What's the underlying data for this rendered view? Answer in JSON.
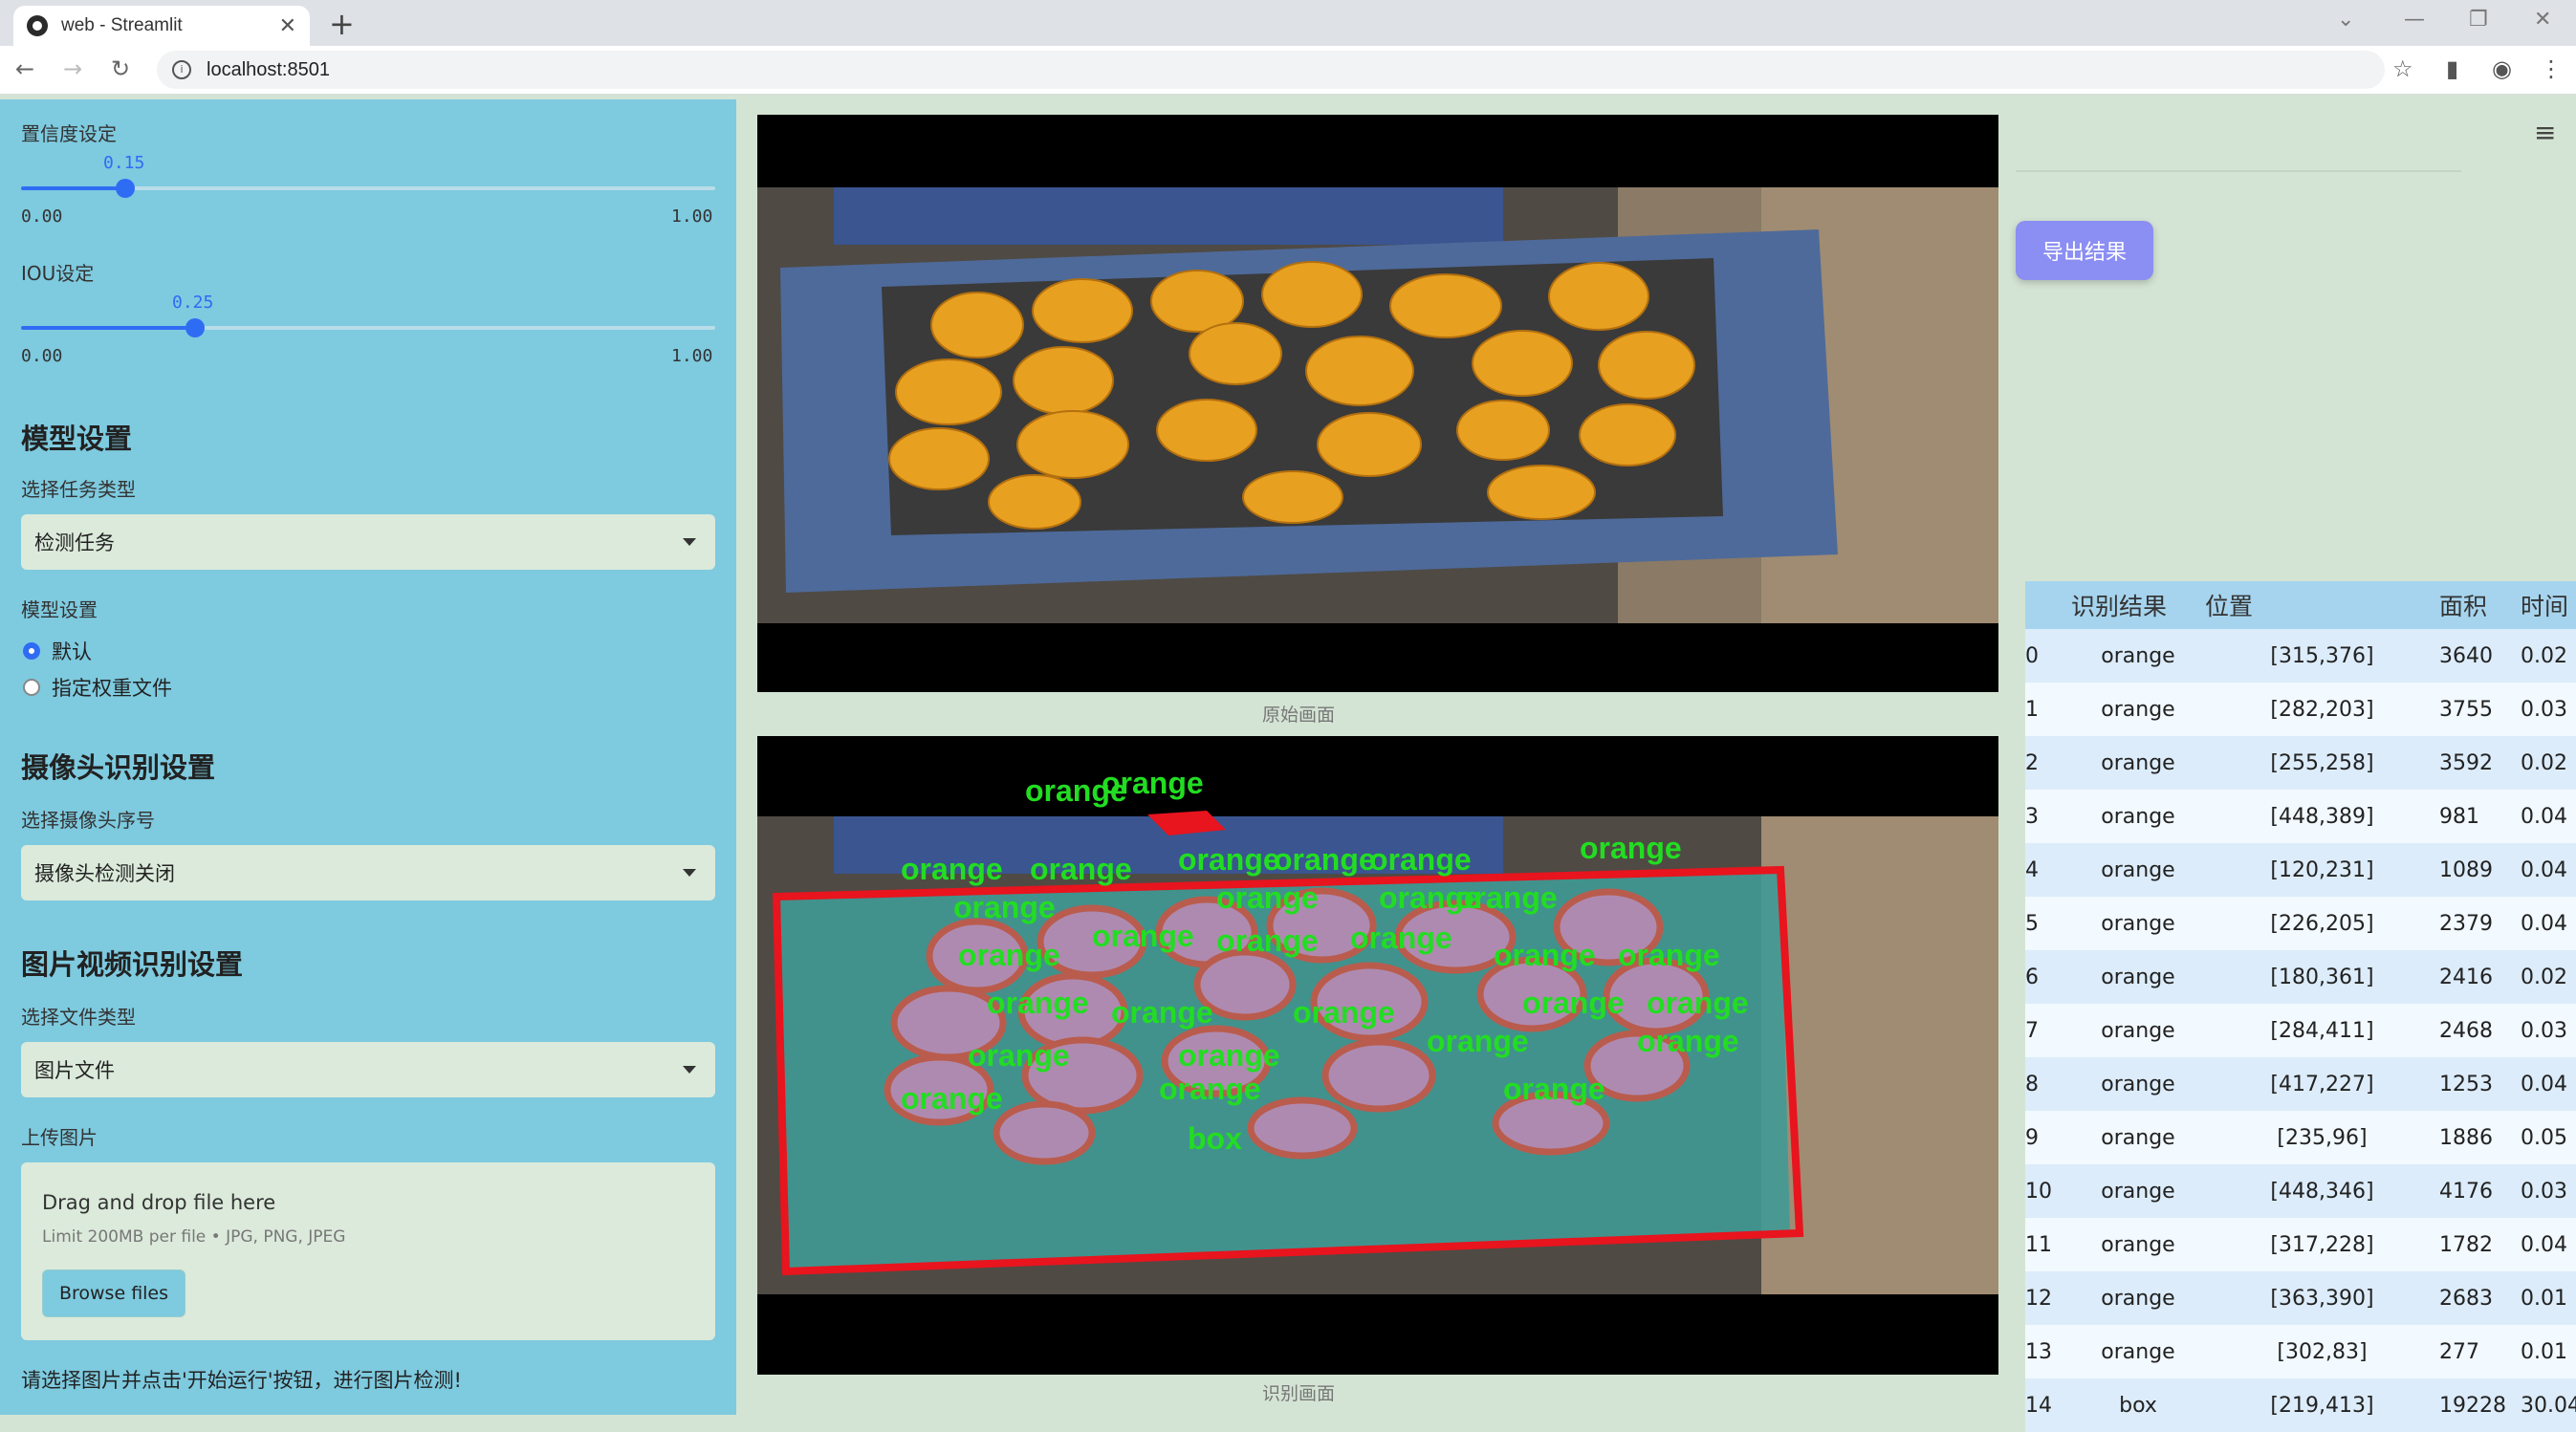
{
  "browser": {
    "tab_title": "web - Streamlit",
    "url": "localhost:8501"
  },
  "sidebar": {
    "confidence": {
      "label": "置信度设定",
      "value": "0.15",
      "fraction": 0.15,
      "min": "0.00",
      "max": "1.00"
    },
    "iou": {
      "label": "IOU设定",
      "value": "0.25",
      "fraction": 0.25,
      "min": "0.00",
      "max": "1.00"
    },
    "model_section": "模型设置",
    "task_label": "选择任务类型",
    "task_value": "检测任务",
    "model_label": "模型设置",
    "radio_default": "默认",
    "radio_custom": "指定权重文件",
    "camera_section": "摄像头识别设置",
    "camera_label": "选择摄像头序号",
    "camera_value": "摄像头检测关闭",
    "media_section": "图片视频识别设置",
    "filetype_label": "选择文件类型",
    "filetype_value": "图片文件",
    "upload_label": "上传图片",
    "upload_drag": "Drag and drop file here",
    "upload_limit": "Limit 200MB per file • JPG, PNG, JPEG",
    "browse_label": "Browse files",
    "hint": "请选择图片并点击'开始运行'按钮，进行图片检测!"
  },
  "main": {
    "original_caption": "原始画面",
    "result_caption": "识别画面",
    "detection_label": "orange",
    "box_label": "box"
  },
  "right": {
    "export_label": "导出结果",
    "columns": [
      "",
      "识别结果",
      "位置",
      "面积",
      "时间"
    ],
    "rows": [
      [
        "0",
        "orange",
        "[315,376]",
        "3640",
        "0.02"
      ],
      [
        "1",
        "orange",
        "[282,203]",
        "3755",
        "0.03"
      ],
      [
        "2",
        "orange",
        "[255,258]",
        "3592",
        "0.02"
      ],
      [
        "3",
        "orange",
        "[448,389]",
        "981",
        "0.04"
      ],
      [
        "4",
        "orange",
        "[120,231]",
        "1089",
        "0.04"
      ],
      [
        "5",
        "orange",
        "[226,205]",
        "2379",
        "0.04"
      ],
      [
        "6",
        "orange",
        "[180,361]",
        "2416",
        "0.02"
      ],
      [
        "7",
        "orange",
        "[284,411]",
        "2468",
        "0.03"
      ],
      [
        "8",
        "orange",
        "[417,227]",
        "1253",
        "0.04"
      ],
      [
        "9",
        "orange",
        "[235,96]",
        "1886",
        "0.05"
      ],
      [
        "10",
        "orange",
        "[448,346]",
        "4176",
        "0.03"
      ],
      [
        "11",
        "orange",
        "[317,228]",
        "1782",
        "0.04"
      ],
      [
        "12",
        "orange",
        "[363,390]",
        "2683",
        "0.01"
      ],
      [
        "13",
        "orange",
        "[302,83]",
        "277",
        "0.01"
      ],
      [
        "14",
        "box",
        "[219,413]",
        "19228",
        "30.04"
      ]
    ]
  }
}
